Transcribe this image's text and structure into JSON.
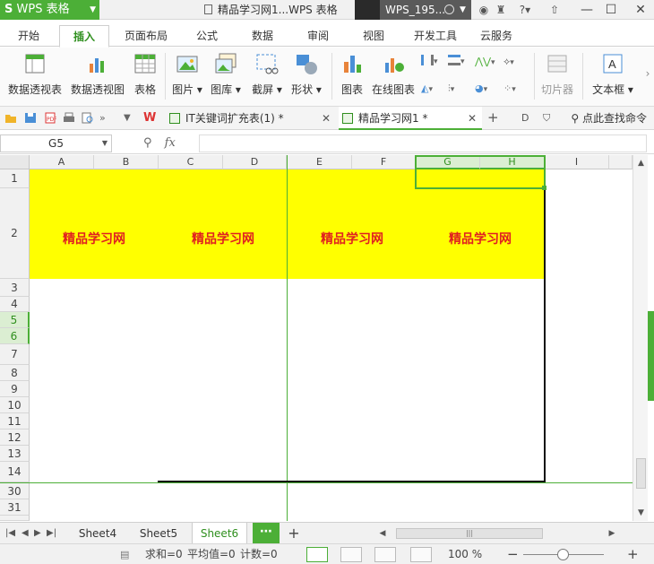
{
  "app": {
    "name": "WPS 表格",
    "window_title": "精品学习网1...WPS 表格",
    "user": "WPS_195...",
    "help": "?"
  },
  "menu": {
    "tabs": [
      "开始",
      "插入",
      "页面布局",
      "公式",
      "数据",
      "审阅",
      "视图",
      "开发工具",
      "云服务"
    ],
    "active": "插入"
  },
  "ribbon": {
    "pivot_table": "数据透视表",
    "pivot_chart": "数据透视图",
    "table": "表格",
    "picture": "图片",
    "gallery": "图库",
    "screenshot": "截屏",
    "shapes": "形状",
    "chart": "图表",
    "online_chart": "在线图表",
    "slicer": "切片器",
    "textbox": "文本框"
  },
  "doc_tabs": [
    {
      "label": "IT关键词扩充表(1) *",
      "active": false
    },
    {
      "label": "精品学习网1 *",
      "active": true
    }
  ],
  "find_command": "点此查找命令",
  "formula_bar": {
    "cell_ref": "G5",
    "fx_label": "fx",
    "value": ""
  },
  "columns": [
    "A",
    "B",
    "C",
    "D",
    "E",
    "F",
    "G",
    "H",
    "I"
  ],
  "rows": [
    "1",
    "2",
    "3",
    "4",
    "5",
    "6",
    "7",
    "8",
    "9",
    "10",
    "11",
    "12",
    "13",
    "14",
    "30",
    "31"
  ],
  "cells": {
    "row2": [
      "精品学习网",
      "精品学习网",
      "精品学习网",
      "精品学习网"
    ]
  },
  "sheets": {
    "tabs": [
      "Sheet4",
      "Sheet5",
      "Sheet6"
    ],
    "active": "Sheet6",
    "more": "⋯",
    "add": "+"
  },
  "status": {
    "sum": "求和=0",
    "average": "平均值=0",
    "count": "计数=0",
    "zoom": "100 %"
  },
  "colors": {
    "brand": "#4caf37",
    "highlight_fill": "#ffff00",
    "cell_text": "#e02020"
  }
}
